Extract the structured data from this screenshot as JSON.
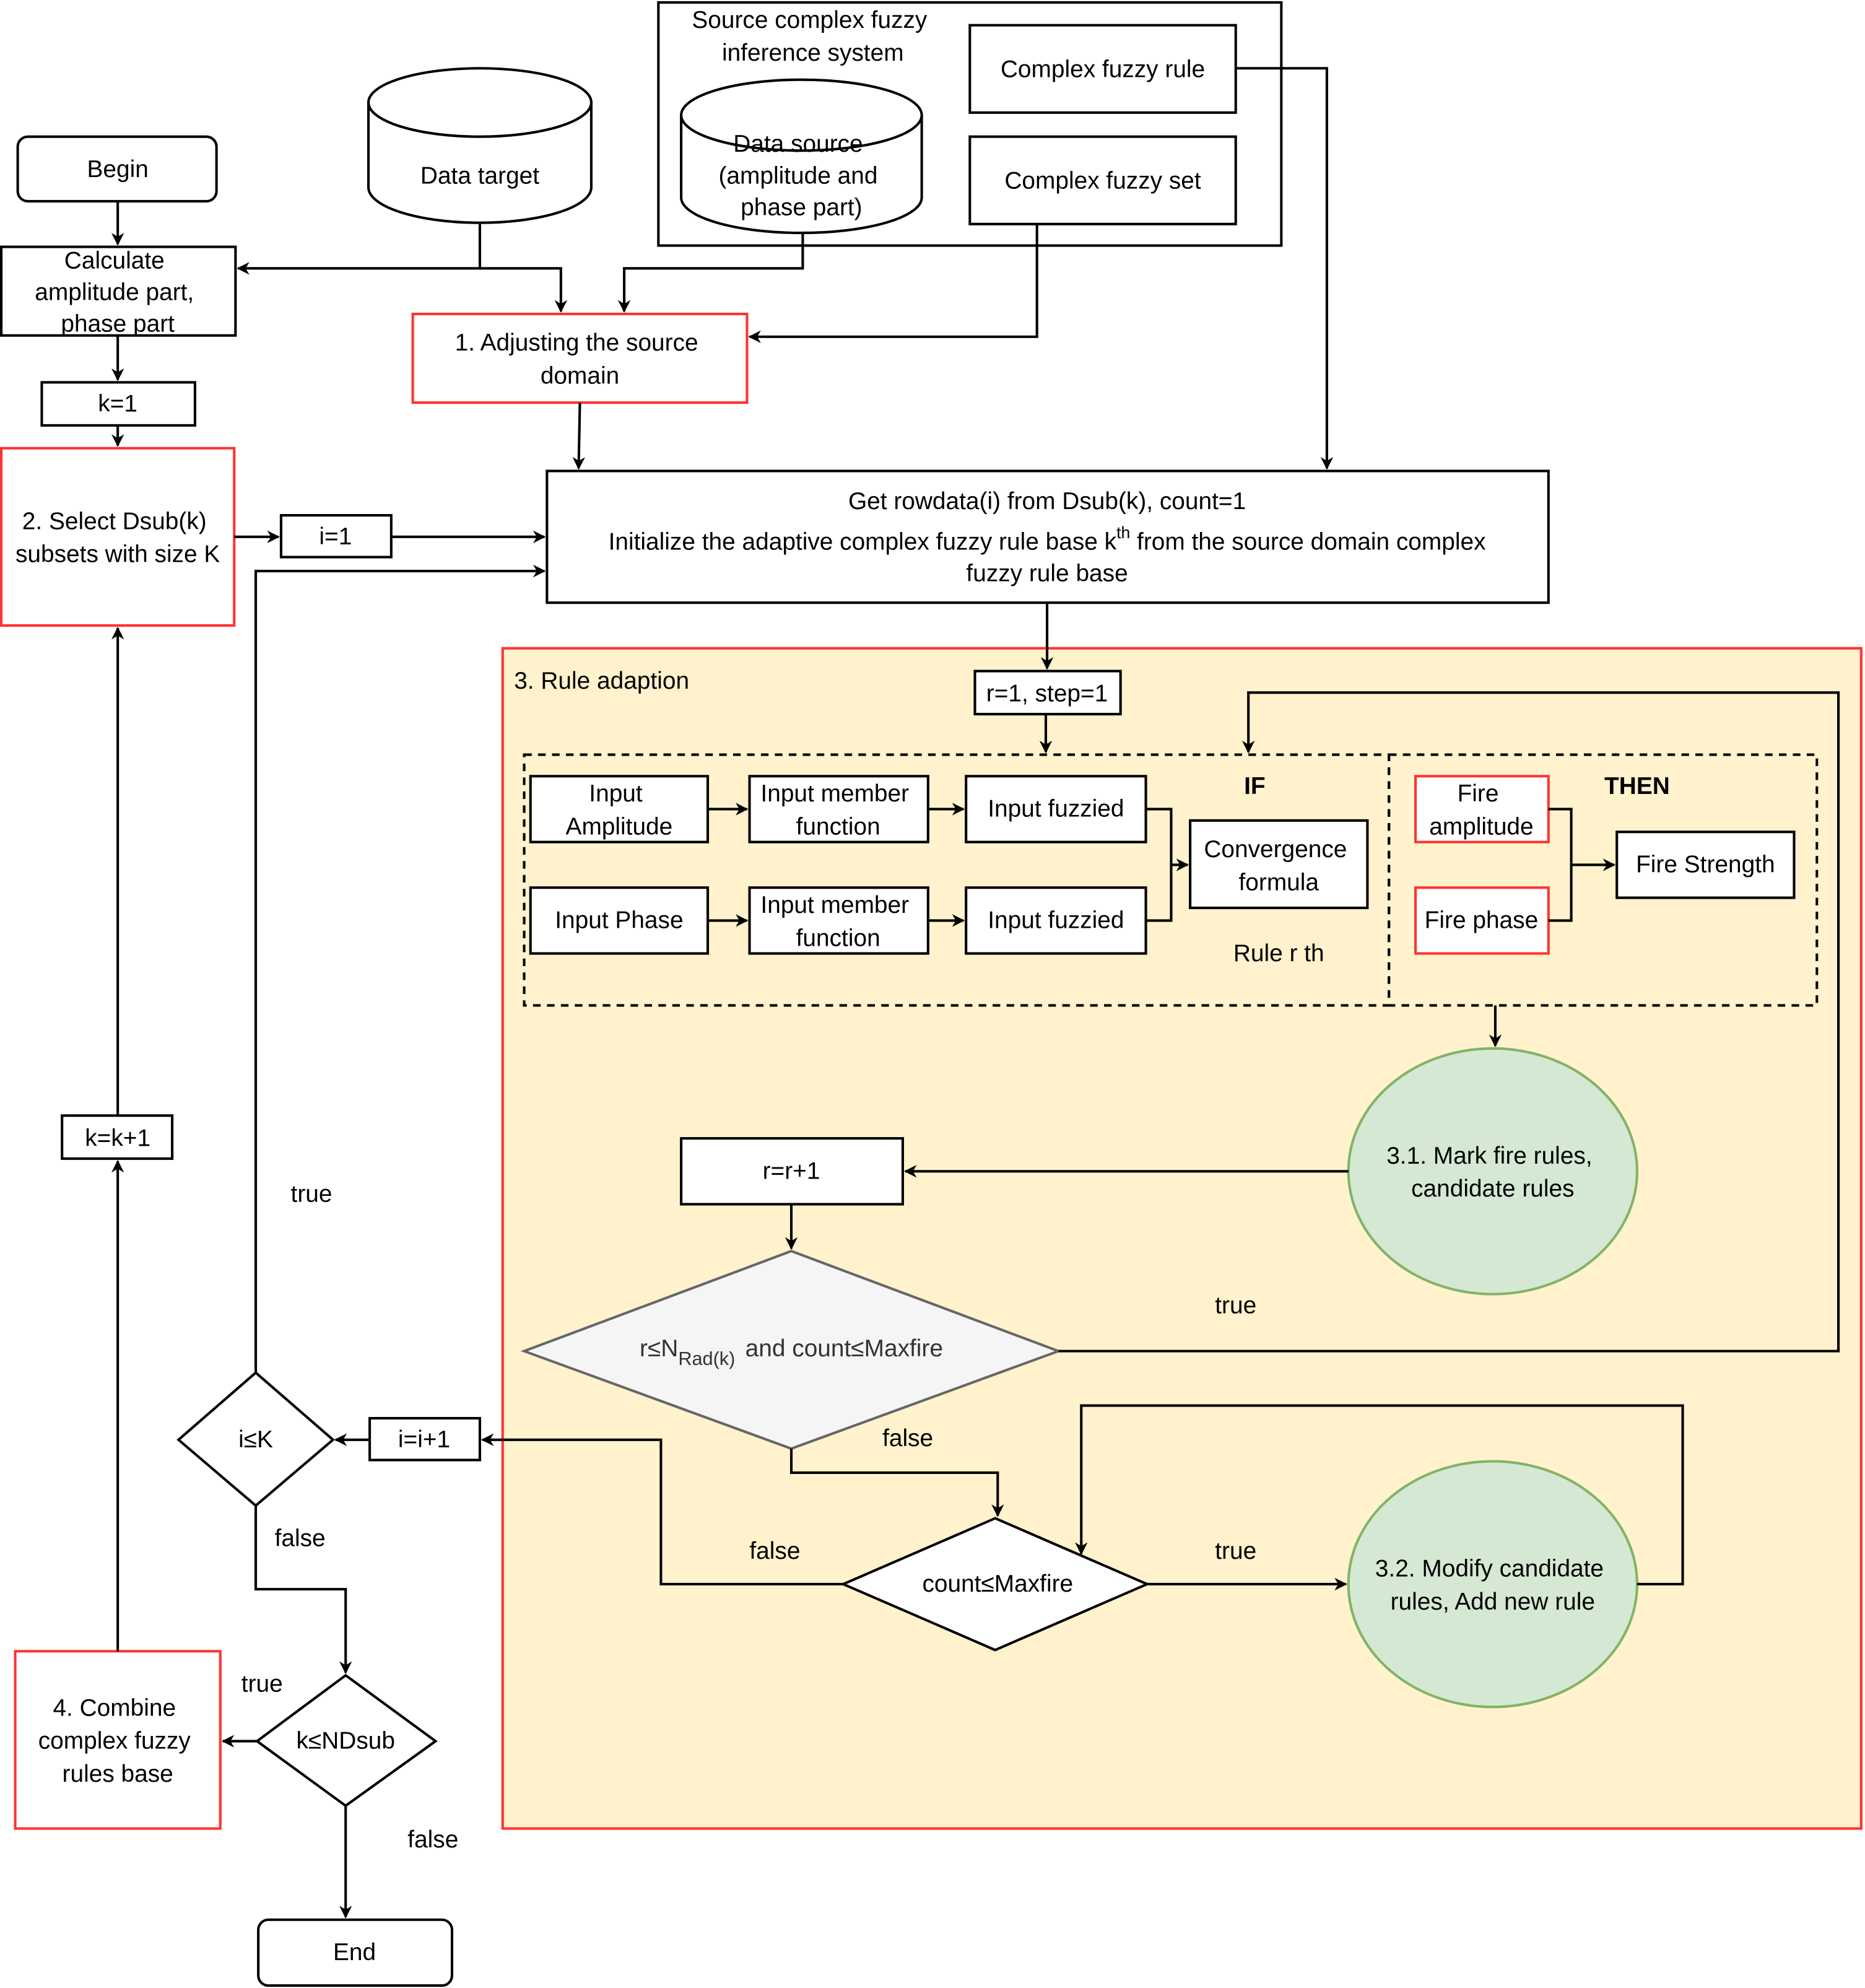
{
  "colors": {
    "highlight_border": "#ff3333",
    "rule_adaption_fill": "#fff2cc",
    "process_fill": "#d5e8d4",
    "process_border": "#82b366",
    "decision_fill": "#f5f5f5",
    "decision_border": "#666666"
  },
  "nodes": {
    "begin": "Begin",
    "calculate": [
      "Calculate",
      "amplitude part,",
      "phase part"
    ],
    "k_init": "k=1",
    "select_dsub": [
      "2. Select  Dsub(k)",
      "subsets with size K"
    ],
    "i_init": "i=1",
    "k_increment": "k=k+1",
    "data_target": "Data target",
    "source_system_title": [
      "Source complex fuzzy",
      "inference system"
    ],
    "data_source": [
      "Data source",
      "(amplitude and",
      "phase part)"
    ],
    "complex_fuzzy_rule": "Complex fuzzy rule",
    "complex_fuzzy_set": "Complex fuzzy set",
    "adjust_domain": [
      "1. Adjusting the source",
      "domain"
    ],
    "get_rowdata": {
      "line1": "Get rowdata(i) from Dsub(k), count=1",
      "line2_pre": "Initialize the adaptive complex fuzzy rule base k",
      "line2_sup": "th",
      "line2_post": " from the source domain complex",
      "line3": "fuzzy rule base"
    },
    "rule_adaption_title": "3. Rule adaption",
    "r_init": "r=1, step=1",
    "if_label": "IF",
    "then_label": "THEN",
    "input_amplitude": [
      "Input",
      "Amplitude"
    ],
    "input_phase": "Input Phase",
    "input_member_function": [
      "Input member",
      "function"
    ],
    "input_fuzzied": "Input fuzzied",
    "convergence_formula": [
      "Convergence",
      "formula"
    ],
    "rule_r_th": "Rule r th",
    "fire_amplitude": [
      "Fire",
      "amplitude"
    ],
    "fire_phase": "Fire phase",
    "fire_strength": "Fire Strength",
    "mark_fire_rules": [
      "3.1. Mark fire rules,",
      "candidate rules"
    ],
    "r_increment": "r=r+1",
    "rule_condition": {
      "pre": "r≤N",
      "sub": "Rad(k)",
      "post": "and count≤Maxfire"
    },
    "count_condition": "count≤Maxfire",
    "modify_rules": [
      "3.2. Modify candidate",
      "rules, Add new rule"
    ],
    "i_increment": "i=i+1",
    "i_condition": "i≤K",
    "k_condition": "k≤NDsub",
    "combine": [
      "4. Combine",
      "complex fuzzy",
      "rules base"
    ],
    "end": "End"
  },
  "edge_labels": {
    "true": "true",
    "false": "false"
  }
}
